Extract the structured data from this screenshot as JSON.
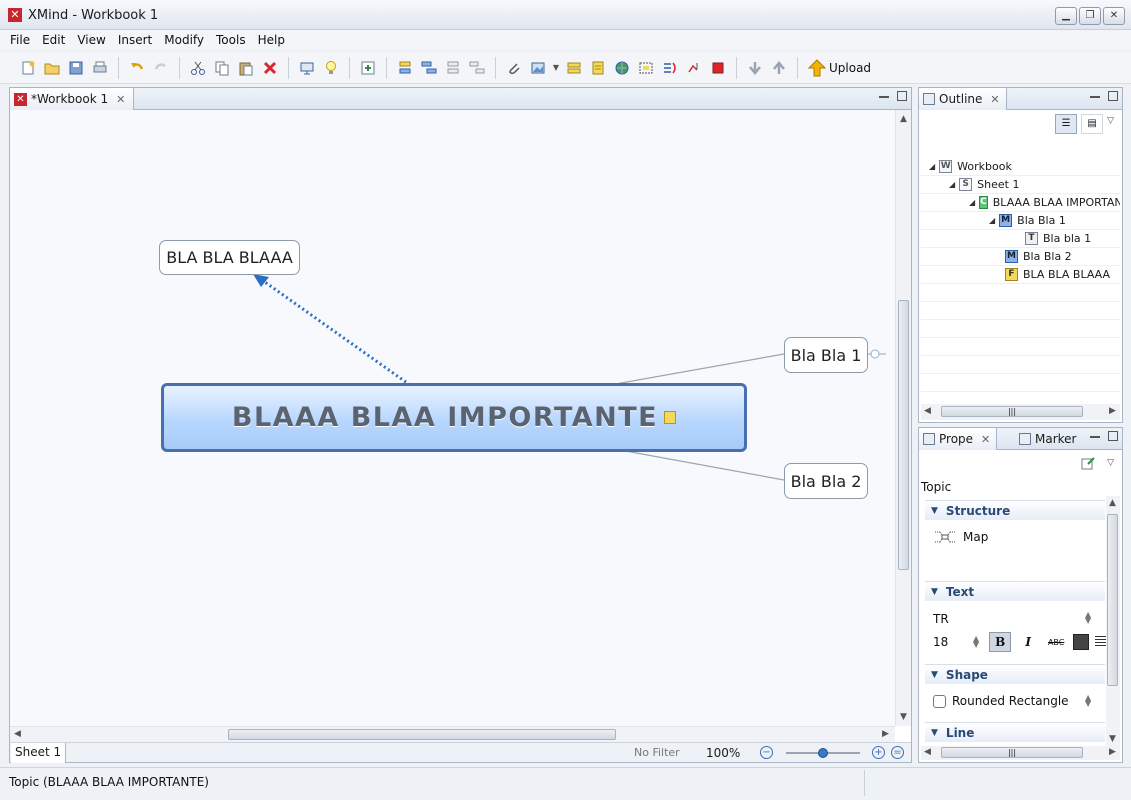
{
  "window": {
    "title": "XMind - Workbook 1",
    "logo_glyph": "✕",
    "controls": [
      "▁",
      "❐",
      "✕"
    ]
  },
  "menu": [
    "File",
    "Edit",
    "View",
    "Insert",
    "Modify",
    "Tools",
    "Help"
  ],
  "toolbar": {
    "icons": [
      "new-file-icon",
      "open-folder-icon",
      "save-icon",
      "print-icon",
      "undo-icon",
      "redo-icon",
      "cut-icon",
      "copy-icon",
      "paste-icon",
      "delete-icon",
      "presentation-icon",
      "lightbulb-icon",
      "new-sheet-icon",
      "insert-topic-icon",
      "insert-subtopic-icon",
      "insert-before-icon",
      "insert-parent-icon",
      "attachment-icon",
      "image-icon",
      "boundary-icon",
      "note-icon",
      "hyperlink-icon",
      "summary-icon",
      "relationship-icon",
      "drill-down-icon",
      "stop-icon",
      "move-down-icon",
      "move-up-icon"
    ],
    "upload_label": "Upload"
  },
  "editor": {
    "tab_label": "*Workbook 1",
    "sheet_tab": "Sheet 1",
    "filter_label": "No Filter",
    "zoom": "100%"
  },
  "mindmap": {
    "central": "BLAAA BLAA IMPORTANTE",
    "float_topic": "BLA BLA BLAAA",
    "subtopic_1": "Bla Bla 1",
    "subtopic_2": "Bla Bla 2"
  },
  "outline": {
    "tab_label": "Outline",
    "rows": [
      {
        "icon": "W",
        "label": "Workbook"
      },
      {
        "icon": "S",
        "label": "Sheet 1"
      },
      {
        "icon": "C",
        "label": "BLAAA BLAA IMPORTAN"
      },
      {
        "icon": "M",
        "label": "Bla Bla 1"
      },
      {
        "icon": "T",
        "label": "Bla bla 1"
      },
      {
        "icon": "M",
        "label": "Bla Bla 2"
      },
      {
        "icon": "F",
        "label": "BLA BLA BLAAA"
      }
    ]
  },
  "properties": {
    "tab_label": "Prope",
    "marker_tab_label": "Marker",
    "type_label": "Topic",
    "structure_header": "Structure",
    "structure_value": "Map",
    "text_header": "Text",
    "font_name": "TR",
    "font_size": "18",
    "bold_label": "B",
    "italic_label": "I",
    "strike_label": "ABC",
    "text_color": "#444444",
    "shape_header": "Shape",
    "shape_value": "Rounded Rectangle",
    "line_header": "Line"
  },
  "status": {
    "text": "Topic (BLAAA BLAA IMPORTANTE)"
  },
  "colors": {
    "accent": "#4a6fb0",
    "relationship": "#2a6fc4",
    "brand": "#c8262c"
  }
}
